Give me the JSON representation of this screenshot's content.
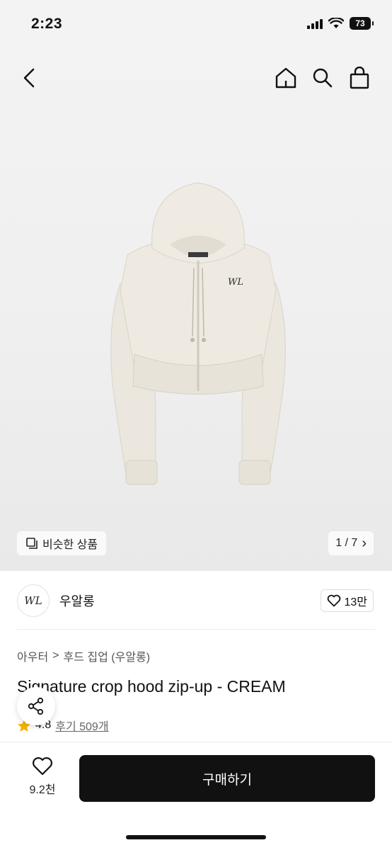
{
  "status_bar": {
    "time": "2:23",
    "battery": "73"
  },
  "header": {
    "icons": [
      "back-icon",
      "home-icon",
      "search-icon",
      "shopping-bag-icon"
    ]
  },
  "gallery": {
    "similar_label": "비슷한 상품",
    "page_indicator": "1 / 7",
    "chevron": "›"
  },
  "brand": {
    "logo_text": "WL",
    "name": "우알롱",
    "like_count": "13만"
  },
  "breadcrumb": {
    "category": "아우터",
    "separator": ">",
    "subcategory": "후드 집업 (우알롱)"
  },
  "product": {
    "title": "Signature crop hood zip-up - CREAM",
    "rating": "4.8",
    "reviews": "후기 509개"
  },
  "bottom_bar": {
    "wish_count": "9.2천",
    "buy_label": "구매하기"
  },
  "colors": {
    "accent": "#111111",
    "star": "#f5b301",
    "hoodie": "#ece8df"
  }
}
